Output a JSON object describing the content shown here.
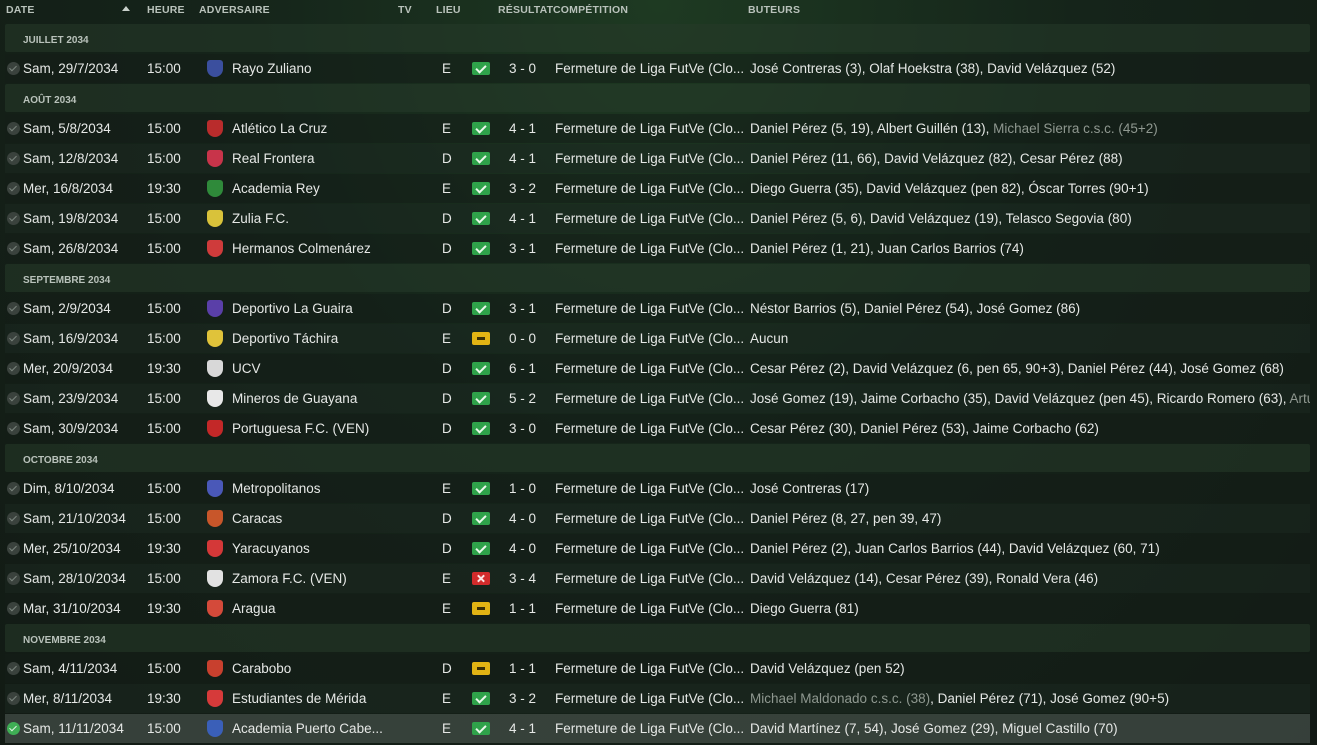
{
  "headers": {
    "date": "DATE",
    "time": "HEURE",
    "opponent": "ADVERSAIRE",
    "tv": "TV",
    "venue": "LIEU",
    "result": "RÉSULTAT",
    "competition": "COMPÉTITION",
    "scorers": "BUTEURS"
  },
  "groups": [
    {
      "month": "JUILLET 2034",
      "matches": [
        {
          "date": "Sam, 29/7/2034",
          "time": "15:00",
          "opponent": "Rayo Zuliano",
          "crest": "#3b4f9e",
          "venue": "E",
          "outcome": "win",
          "score": "3 - 0",
          "competition": "Fermeture de Liga FutVe (Clo...",
          "scorers": "José Contreras (3), Olaf Hoekstra (38), David Velázquez (52)",
          "scorers_own": ""
        }
      ]
    },
    {
      "month": "AOÛT 2034",
      "matches": [
        {
          "date": "Sam, 5/8/2034",
          "time": "15:00",
          "opponent": "Atlético La Cruz",
          "crest": "#b92c2c",
          "venue": "E",
          "outcome": "win",
          "score": "4 - 1",
          "competition": "Fermeture de Liga FutVe (Clo...",
          "scorers": "Daniel Pérez (5, 19), Albert Guillén (13), ",
          "scorers_own": "Michael Sierra c.s.c. (45+2)"
        },
        {
          "date": "Sam, 12/8/2034",
          "time": "15:00",
          "opponent": "Real Frontera",
          "crest": "#c8344a",
          "venue": "D",
          "outcome": "win",
          "score": "4 - 1",
          "competition": "Fermeture de Liga FutVe (Clo...",
          "scorers": "Daniel Pérez (11, 66), David Velázquez (82), Cesar Pérez (88)",
          "scorers_own": ""
        },
        {
          "date": "Mer, 16/8/2034",
          "time": "19:30",
          "opponent": "Academia Rey",
          "crest": "#2f8a3a",
          "venue": "E",
          "outcome": "win",
          "score": "3 - 2",
          "competition": "Fermeture de Liga FutVe (Clo...",
          "scorers": "Diego Guerra (35), David Velázquez (pen 82), Óscar Torres (90+1)",
          "scorers_own": ""
        },
        {
          "date": "Sam, 19/8/2034",
          "time": "15:00",
          "opponent": "Zulia F.C.",
          "crest": "#d9c23a",
          "venue": "D",
          "outcome": "win",
          "score": "4 - 1",
          "competition": "Fermeture de Liga FutVe (Clo...",
          "scorers": "Daniel Pérez (5, 6), David Velázquez (19), Telasco Segovia (80)",
          "scorers_own": ""
        },
        {
          "date": "Sam, 26/8/2034",
          "time": "15:00",
          "opponent": "Hermanos Colmenárez",
          "crest": "#cf3b3b",
          "venue": "D",
          "outcome": "win",
          "score": "3 - 1",
          "competition": "Fermeture de Liga FutVe (Clo...",
          "scorers": "Daniel Pérez (1, 21), Juan Carlos Barrios (74)",
          "scorers_own": ""
        }
      ]
    },
    {
      "month": "SEPTEMBRE 2034",
      "matches": [
        {
          "date": "Sam, 2/9/2034",
          "time": "15:00",
          "opponent": "Deportivo La Guaira",
          "crest": "#5a3fa8",
          "venue": "D",
          "outcome": "win",
          "score": "3 - 1",
          "competition": "Fermeture de Liga FutVe (Clo...",
          "scorers": "Néstor Barrios (5), Daniel Pérez (54), José Gomez (86)",
          "scorers_own": ""
        },
        {
          "date": "Sam, 16/9/2034",
          "time": "15:00",
          "opponent": "Deportivo Táchira",
          "crest": "#e0c33a",
          "venue": "E",
          "outcome": "draw",
          "score": "0 - 0",
          "competition": "Fermeture de Liga FutVe (Clo...",
          "scorers": "Aucun",
          "scorers_own": ""
        },
        {
          "date": "Mer, 20/9/2034",
          "time": "19:30",
          "opponent": "UCV",
          "crest": "#d8d8d8",
          "venue": "D",
          "outcome": "win",
          "score": "6 - 1",
          "competition": "Fermeture de Liga FutVe (Clo...",
          "scorers": "Cesar Pérez (2), David Velázquez (6, pen 65, 90+3), Daniel Pérez (44), José Gomez (68)",
          "scorers_own": ""
        },
        {
          "date": "Sam, 23/9/2034",
          "time": "15:00",
          "opponent": "Mineros de Guayana",
          "crest": "#e8e8e8",
          "venue": "D",
          "outcome": "win",
          "score": "5 - 2",
          "competition": "Fermeture de Liga FutVe (Clo...",
          "scorers": "José Gomez (19), Jaime Corbacho (35), David Velázquez (pen 45), Ricardo Romero (63), ",
          "scorers_own": "Artu"
        },
        {
          "date": "Sam, 30/9/2034",
          "time": "15:00",
          "opponent": "Portuguesa F.C. (VEN)",
          "crest": "#c32828",
          "venue": "D",
          "outcome": "win",
          "score": "3 - 0",
          "competition": "Fermeture de Liga FutVe (Clo...",
          "scorers": "Cesar Pérez (30), Daniel Pérez (53), Jaime Corbacho (62)",
          "scorers_own": ""
        }
      ]
    },
    {
      "month": "OCTOBRE 2034",
      "matches": [
        {
          "date": "Dim, 8/10/2034",
          "time": "15:00",
          "opponent": "Metropolitanos",
          "crest": "#4a58b8",
          "venue": "E",
          "outcome": "win",
          "score": "1 - 0",
          "competition": "Fermeture de Liga FutVe (Clo...",
          "scorers": "José Contreras (17)",
          "scorers_own": ""
        },
        {
          "date": "Sam, 21/10/2034",
          "time": "15:00",
          "opponent": "Caracas",
          "crest": "#c8562a",
          "venue": "D",
          "outcome": "win",
          "score": "4 - 0",
          "competition": "Fermeture de Liga FutVe (Clo...",
          "scorers": "Daniel Pérez (8, 27, pen 39, 47)",
          "scorers_own": ""
        },
        {
          "date": "Mer, 25/10/2034",
          "time": "19:30",
          "opponent": "Yaracuyanos",
          "crest": "#d43838",
          "venue": "D",
          "outcome": "win",
          "score": "4 - 0",
          "competition": "Fermeture de Liga FutVe (Clo...",
          "scorers": "Daniel Pérez (2), Juan Carlos Barrios (44), David Velázquez (60, 71)",
          "scorers_own": ""
        },
        {
          "date": "Sam, 28/10/2034",
          "time": "15:00",
          "opponent": "Zamora F.C. (VEN)",
          "crest": "#e2e2e2",
          "venue": "E",
          "outcome": "loss",
          "score": "3 - 4",
          "competition": "Fermeture de Liga FutVe (Clo...",
          "scorers": "David Velázquez (14), Cesar Pérez (39), Ronald Vera (46)",
          "scorers_own": ""
        },
        {
          "date": "Mar, 31/10/2034",
          "time": "19:30",
          "opponent": "Aragua",
          "crest": "#d44a3a",
          "venue": "E",
          "outcome": "draw",
          "score": "1 - 1",
          "competition": "Fermeture de Liga FutVe (Clo...",
          "scorers": "Diego Guerra (81)",
          "scorers_own": ""
        }
      ]
    },
    {
      "month": "NOVEMBRE 2034",
      "matches": [
        {
          "date": "Sam, 4/11/2034",
          "time": "15:00",
          "opponent": "Carabobo",
          "crest": "#c8402e",
          "venue": "D",
          "outcome": "draw",
          "score": "1 - 1",
          "competition": "Fermeture de Liga FutVe (Clo...",
          "scorers": "David Velázquez (pen 52)",
          "scorers_own": ""
        },
        {
          "date": "Mer, 8/11/2034",
          "time": "19:30",
          "opponent": "Estudiantes de Mérida",
          "crest": "#d63a3a",
          "venue": "E",
          "outcome": "win",
          "score": "3 - 2",
          "competition": "Fermeture de Liga FutVe (Clo...",
          "scorers": "",
          "scorers_own": "Michael Maldonado c.s.c. (38)",
          "scorers_after": ", Daniel Pérez (71), José Gomez (90+5)"
        },
        {
          "date": "Sam, 11/11/2034",
          "time": "15:00",
          "opponent": "Academia Puerto Cabe...",
          "crest": "#3a5fb8",
          "venue": "E",
          "outcome": "win",
          "score": "4 - 1",
          "competition": "Fermeture de Liga FutVe (Clo...",
          "scorers": "David Martínez (7, 54), José Gomez (29), Miguel Castillo (70)",
          "scorers_own": "",
          "selected": true
        }
      ]
    }
  ]
}
